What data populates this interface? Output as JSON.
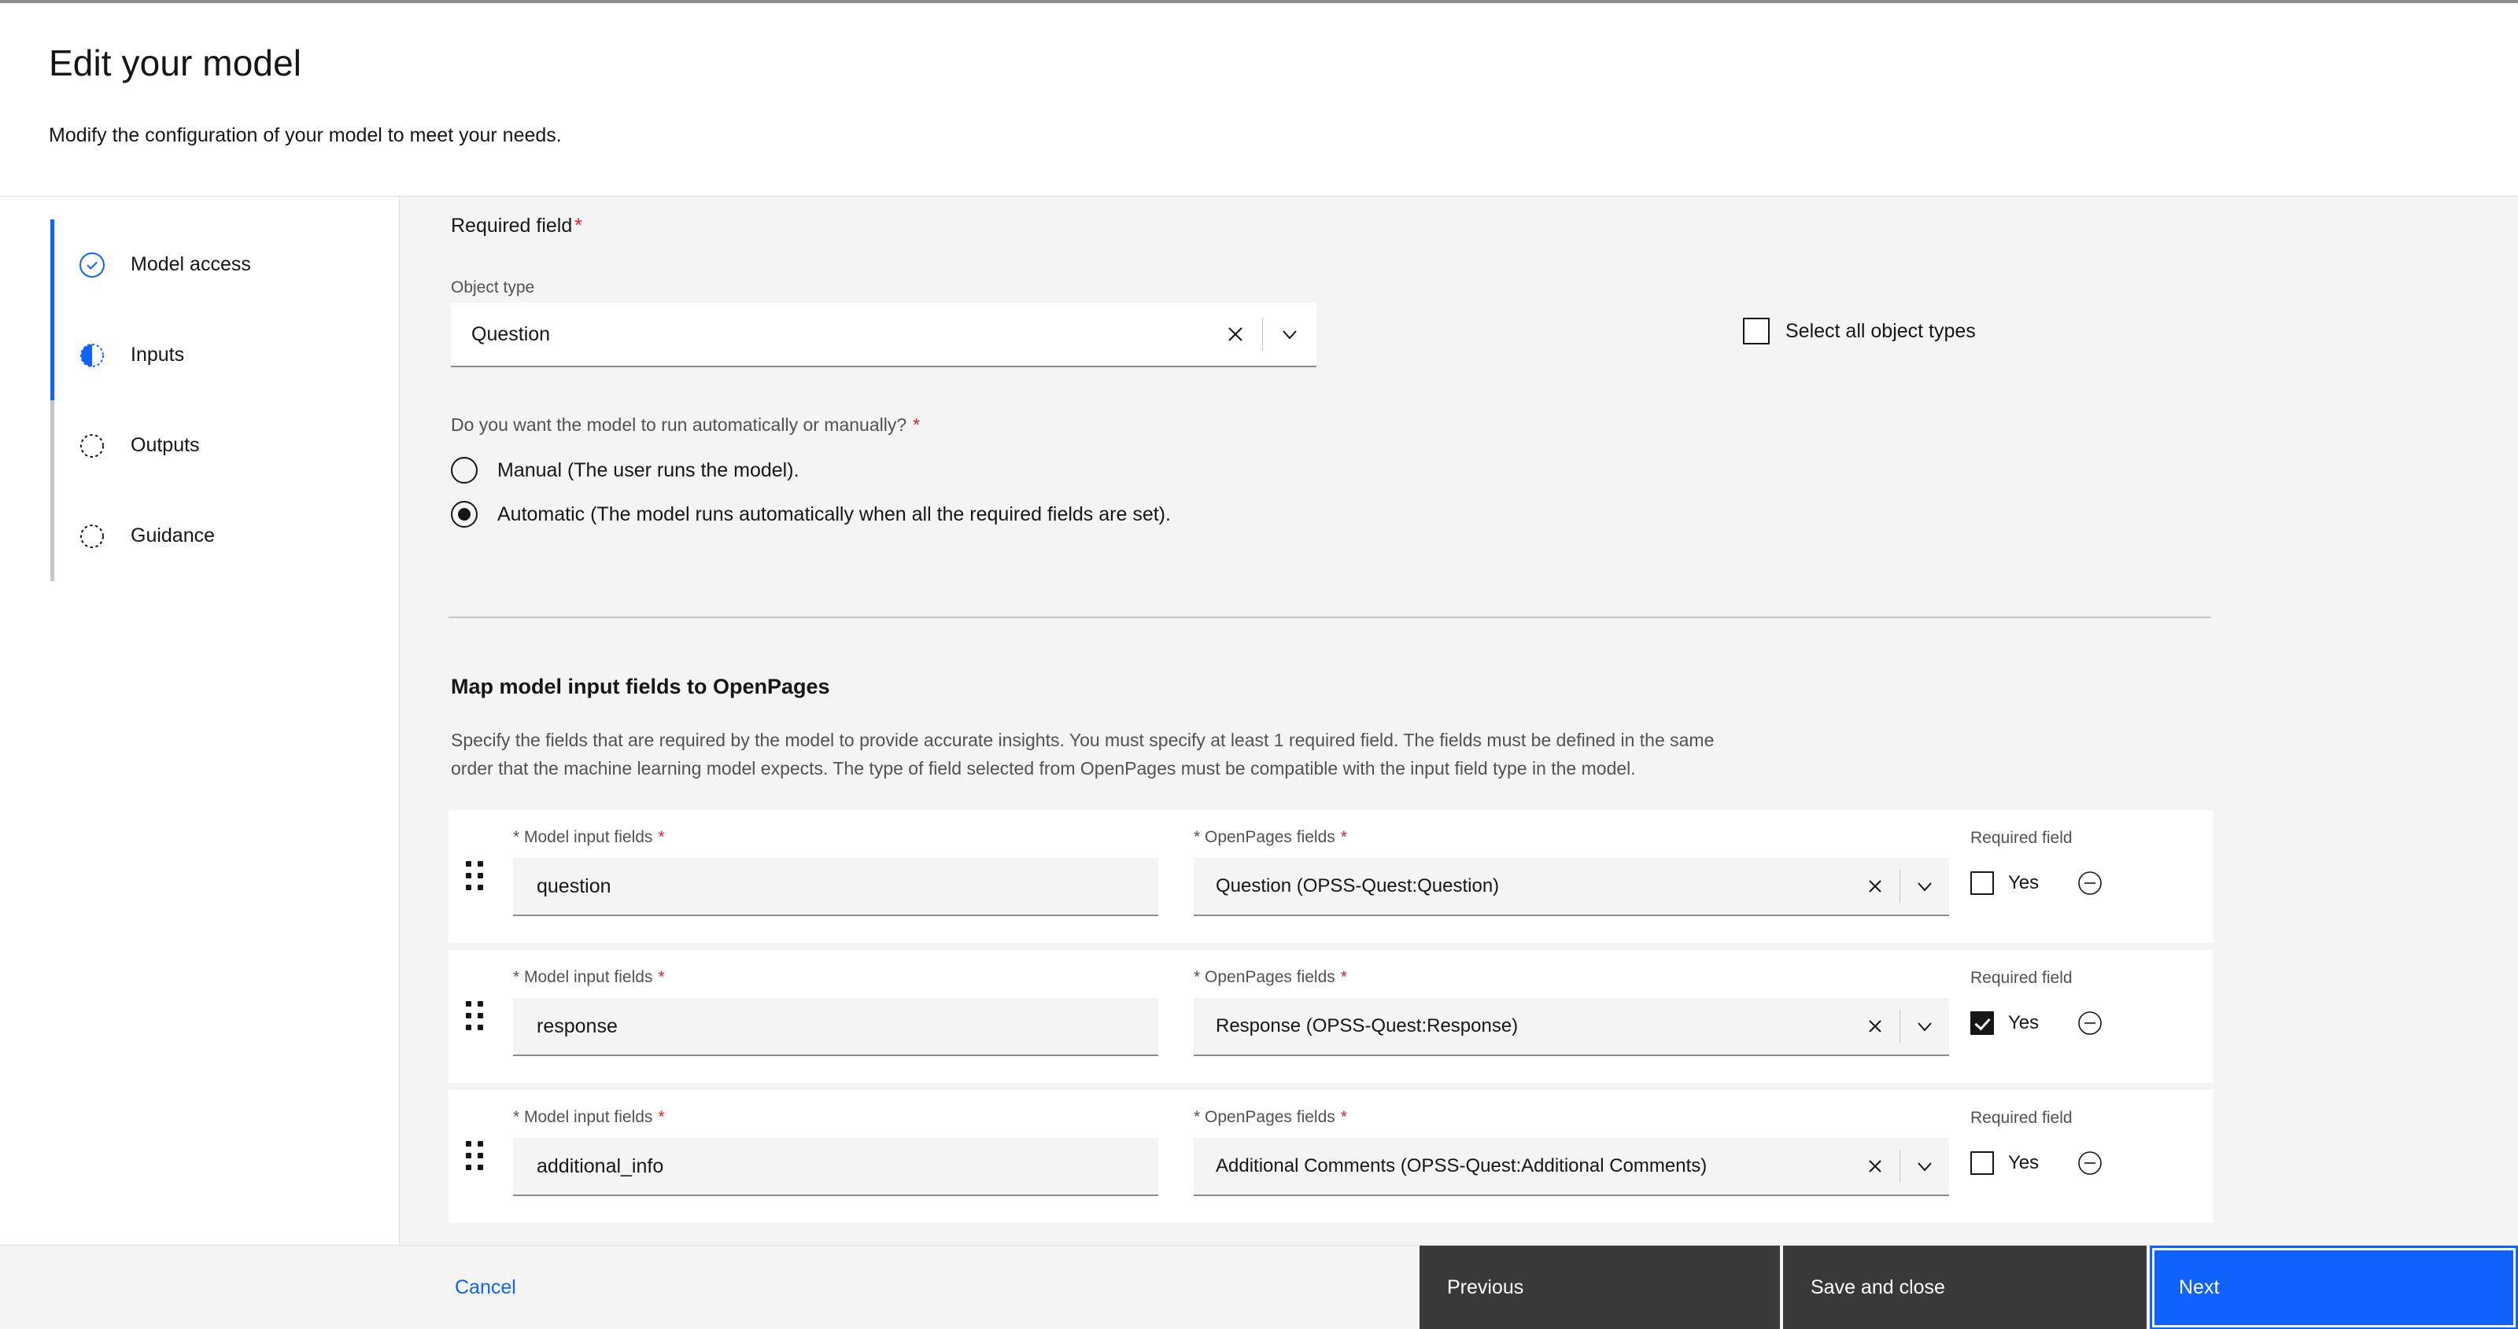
{
  "header": {
    "title": "Edit your model",
    "subtitle": "Modify the configuration of your model to meet your needs."
  },
  "sidebar": {
    "items": [
      {
        "label": "Model access",
        "state": "done",
        "icon": "check-circle-icon"
      },
      {
        "label": "Inputs",
        "state": "current",
        "icon": "half-circle-icon"
      },
      {
        "label": "Outputs",
        "state": "incomplete",
        "icon": "dashed-circle-icon"
      },
      {
        "label": "Guidance",
        "state": "incomplete",
        "icon": "dashed-circle-icon"
      }
    ]
  },
  "main": {
    "required_field_label": "Required field",
    "required_marker": "*",
    "object_type": {
      "label": "Object type",
      "value": "Question",
      "clear_icon": "close-icon",
      "expand_icon": "chevron-down-icon"
    },
    "select_all": {
      "label": "Select all object types",
      "checked": false
    },
    "run_mode": {
      "question": "Do you want the model to run automatically or manually?",
      "required_marker": "*",
      "options": [
        {
          "label": "Manual (The user runs the model).",
          "selected": false
        },
        {
          "label": "Automatic (The model runs automatically when all the required fields are set).",
          "selected": true
        }
      ]
    },
    "mapping": {
      "section_title": "Map model input fields to OpenPages",
      "description": "Specify the fields that are required by the model to provide accurate insights. You must specify at least 1 required field. The fields must be defined in the same order that the machine learning model expects. The type of field selected from OpenPages must be compatible with the input field type in the model.",
      "column_labels": {
        "model_input": "* Model input fields",
        "openpages": "* OpenPages fields",
        "required_field": "Required field",
        "required_marker": "*",
        "yes": "Yes"
      },
      "rows": [
        {
          "drag_handle_icon": "drag-handle-icon",
          "model_input_value": "question",
          "openpages_value": "Question (OPSS-Quest:Question)",
          "required_checked": false,
          "clear_icon": "close-icon",
          "expand_icon": "chevron-down-icon",
          "remove_icon": "subtract-circle-icon"
        },
        {
          "drag_handle_icon": "drag-handle-icon",
          "model_input_value": "response",
          "openpages_value": "Response (OPSS-Quest:Response)",
          "required_checked": true,
          "clear_icon": "close-icon",
          "expand_icon": "chevron-down-icon",
          "remove_icon": "subtract-circle-icon"
        },
        {
          "drag_handle_icon": "drag-handle-icon",
          "model_input_value": "additional_info",
          "openpages_value": "Additional Comments (OPSS-Quest:Additional Comments)",
          "required_checked": false,
          "clear_icon": "close-icon",
          "expand_icon": "chevron-down-icon",
          "remove_icon": "subtract-circle-icon"
        }
      ]
    }
  },
  "footer": {
    "cancel": "Cancel",
    "previous": "Previous",
    "save_and_close": "Save and close",
    "next": "Next"
  },
  "colors": {
    "accent": "#0f62fe",
    "required": "#da1e28",
    "dark_button": "#393939",
    "page_bg": "#f4f4f4",
    "panel_bg": "#ffffff",
    "text": "#161616",
    "muted_text": "#525252"
  }
}
